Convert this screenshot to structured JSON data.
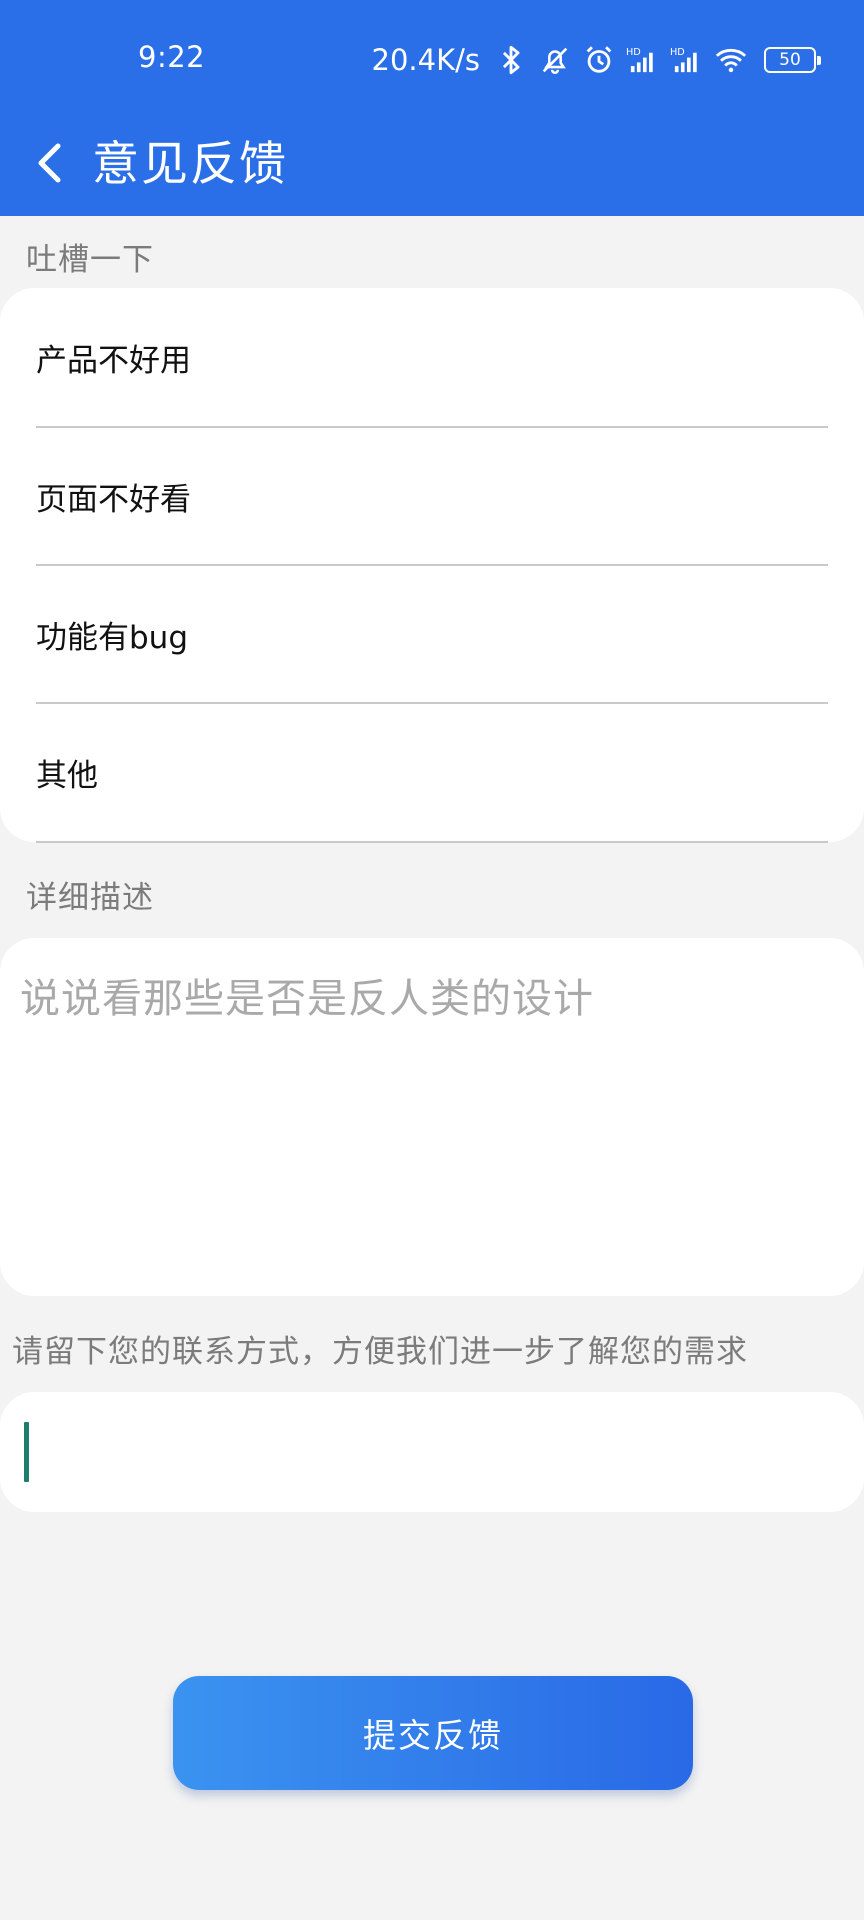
{
  "status_bar": {
    "time": "9:22",
    "net_speed": "20.4K/s",
    "battery": "50",
    "icons": [
      "bluetooth-icon",
      "mute-bell-icon",
      "alarm-icon",
      "hd-signal-icon",
      "hd-signal-icon",
      "wifi-icon",
      "battery-icon"
    ]
  },
  "header": {
    "back_icon": "chevron-left-icon",
    "title": "意见反馈"
  },
  "complaint": {
    "label": "吐槽一下",
    "options": [
      "产品不好用",
      "页面不好看",
      "功能有bug",
      "其他"
    ]
  },
  "description": {
    "label": "详细描述",
    "placeholder": "说说看那些是否是反人类的设计"
  },
  "contact": {
    "label": "请留下您的联系方式，方便我们进一步了解您的需求",
    "value": ""
  },
  "submit": {
    "label": "提交反馈"
  },
  "colors": {
    "header_bg": "#2b6fe8",
    "page_bg": "#f3f3f3",
    "button_gradient_start": "#3b93f0",
    "button_gradient_end": "#2969e6",
    "caret": "#1e7d6b"
  }
}
